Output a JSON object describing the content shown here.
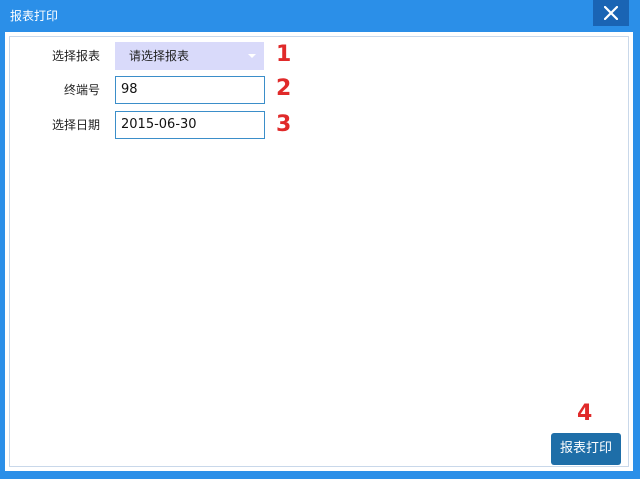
{
  "window": {
    "title": "报表打印"
  },
  "form": {
    "report": {
      "label": "选择报表",
      "value": "请选择报表"
    },
    "terminal": {
      "label": "终端号",
      "value": "98"
    },
    "date": {
      "label": "选择日期",
      "value": "2015-06-30"
    }
  },
  "markers": [
    "1",
    "2",
    "3",
    "4"
  ],
  "print_button": {
    "label": "报表打印"
  },
  "icons": {
    "close": "close-icon",
    "dropdown": "chevron-down-icon"
  },
  "colors": {
    "titlebar": "#2b8fe8",
    "close_button": "#1a64b4",
    "select_bg": "#d9dafa",
    "input_border": "#3b8ec9",
    "marker": "#e02a2a",
    "print_button": "#1e6ea8"
  }
}
